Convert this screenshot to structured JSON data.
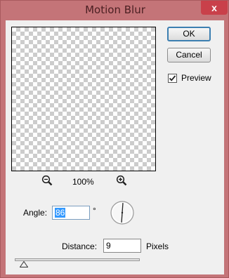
{
  "window": {
    "title": "Motion Blur",
    "close_glyph": "x"
  },
  "buttons": {
    "ok": "OK",
    "cancel": "Cancel"
  },
  "preview_checkbox": {
    "label": "Preview",
    "checked": true
  },
  "zoom": {
    "value": "100%",
    "zoom_out_icon": "zoom-out-icon",
    "zoom_in_icon": "zoom-in-icon"
  },
  "angle": {
    "label": "Angle:",
    "value": "86",
    "unit": "°"
  },
  "distance": {
    "label": "Distance:",
    "value": "9",
    "unit": "Pixels"
  },
  "slider": {
    "level": 0.03
  },
  "colors": {
    "titlebar": "#c47478",
    "close": "#c9404a",
    "accent": "#3399ff"
  }
}
